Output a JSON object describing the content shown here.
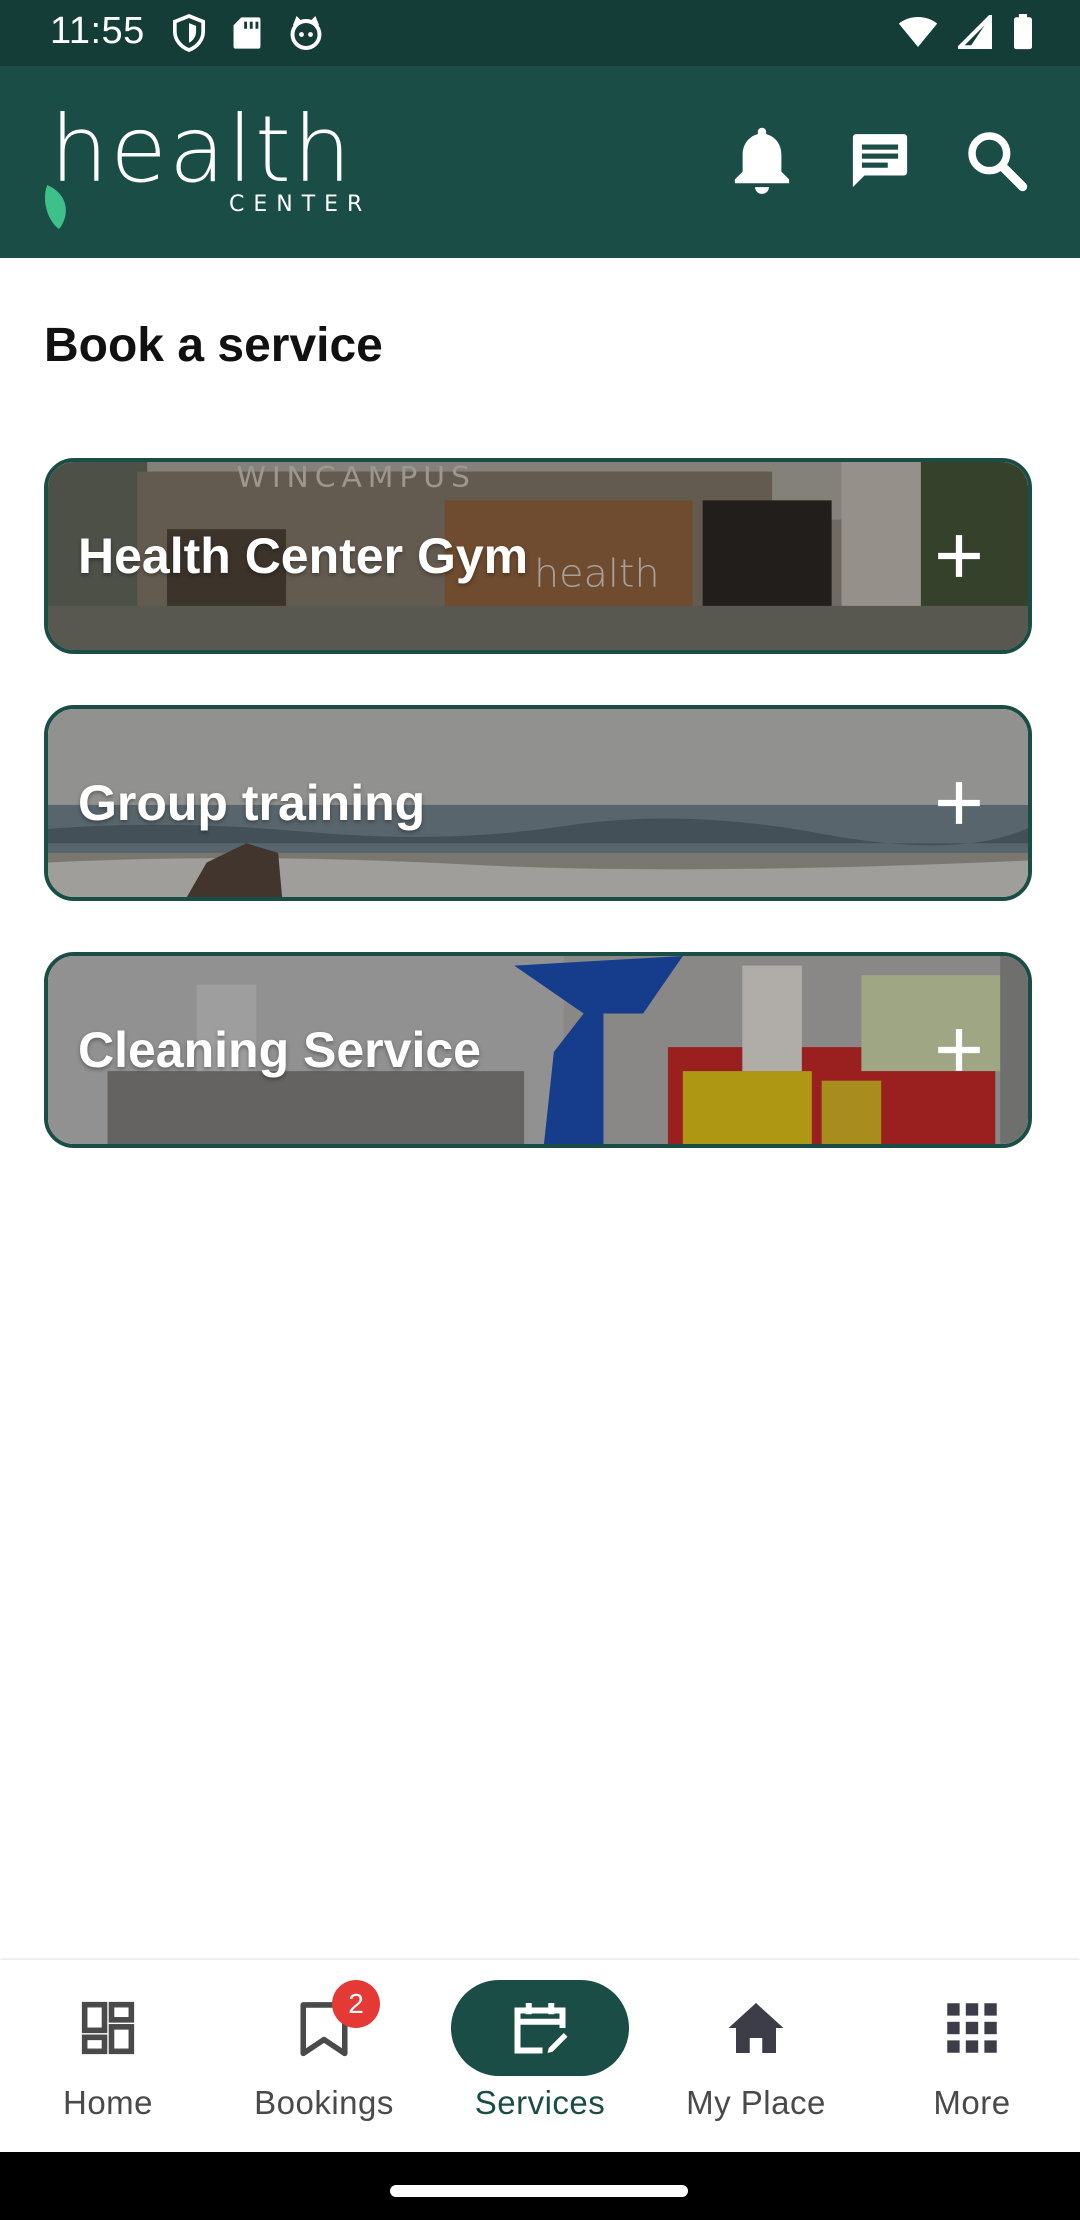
{
  "status_bar": {
    "time": "11:55",
    "left_icons": [
      "shield-icon",
      "sd-card-icon",
      "cat-face-icon"
    ],
    "right_icons": [
      "wifi-icon",
      "cellular-signal-icon",
      "battery-icon"
    ]
  },
  "app_bar": {
    "logo_text": "health",
    "logo_subtext": "CENTER",
    "actions": [
      "bell-icon",
      "chat-icon",
      "search-icon"
    ]
  },
  "main": {
    "title": "Book a service",
    "services": [
      {
        "label": "Health Center Gym",
        "image": "gym-building-photo",
        "action_icon": "plus-icon"
      },
      {
        "label": "Group training",
        "image": "beach-sea-photo",
        "action_icon": "plus-icon"
      },
      {
        "label": "Cleaning Service",
        "image": "cleaning-supplies-photo",
        "action_icon": "plus-icon"
      }
    ]
  },
  "bottom_nav": {
    "items": [
      {
        "label": "Home",
        "icon": "dashboard-icon",
        "active": false
      },
      {
        "label": "Bookings",
        "icon": "bookmark-icon",
        "badge": "2",
        "active": false
      },
      {
        "label": "Services",
        "icon": "calendar-edit-icon",
        "active": true
      },
      {
        "label": "My Place",
        "icon": "home-icon",
        "active": false
      },
      {
        "label": "More",
        "icon": "apps-grid-icon",
        "active": false
      }
    ]
  },
  "colors": {
    "brand_dark": "#1a4d45",
    "status_bar": "#133d36",
    "badge": "#e53935"
  }
}
